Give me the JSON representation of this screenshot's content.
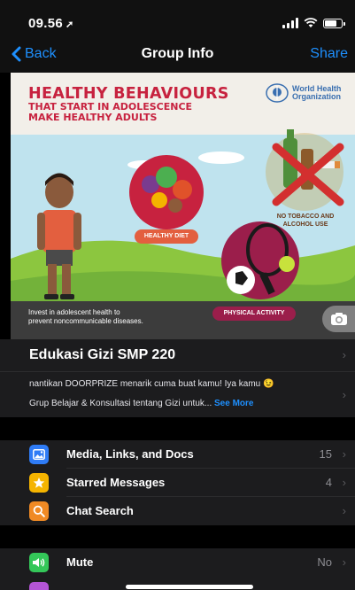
{
  "status": {
    "time": "09.56"
  },
  "nav": {
    "back_label": "Back",
    "title": "Group Info",
    "share_label": "Share"
  },
  "banner": {
    "title": "HEALTHY BEHAVIOURS",
    "subtitle_1": "THAT START IN ADOLESCENCE",
    "subtitle_2": "MAKE HEALTHY ADULTS",
    "org_line_1": "World Health",
    "org_line_2": "Organization",
    "label_diet": "HEALTHY DIET",
    "label_tobacco_1": "NO TOBACCO AND",
    "label_tobacco_2": "ALCOHOL USE",
    "label_activity": "PHYSICAL ACTIVITY",
    "invest_1": "Invest in adolescent health to",
    "invest_2": "prevent noncommunicable diseases."
  },
  "group": {
    "name": "Edukasi Gizi SMP 220",
    "desc_line_1": "nantikan DOORPRIZE menarik cuma buat kamu! Iya kamu 😉",
    "desc_line_2": "Grup Belajar & Konsultasi tentang Gizi untuk...",
    "see_more": "See More"
  },
  "menu": [
    {
      "label": "Media, Links, and Docs",
      "value": "15",
      "icon": "photo-icon",
      "color": "#2f7cf6"
    },
    {
      "label": "Starred Messages",
      "value": "4",
      "icon": "star-icon",
      "color": "#f5b400"
    },
    {
      "label": "Chat Search",
      "value": "",
      "icon": "search-icon",
      "color": "#f08a24"
    }
  ],
  "mute": {
    "label": "Mute",
    "value": "No",
    "icon": "speaker-icon",
    "color": "#34c759"
  },
  "colors": {
    "accent": "#1e90ff",
    "banner_title": "#c7223f"
  }
}
